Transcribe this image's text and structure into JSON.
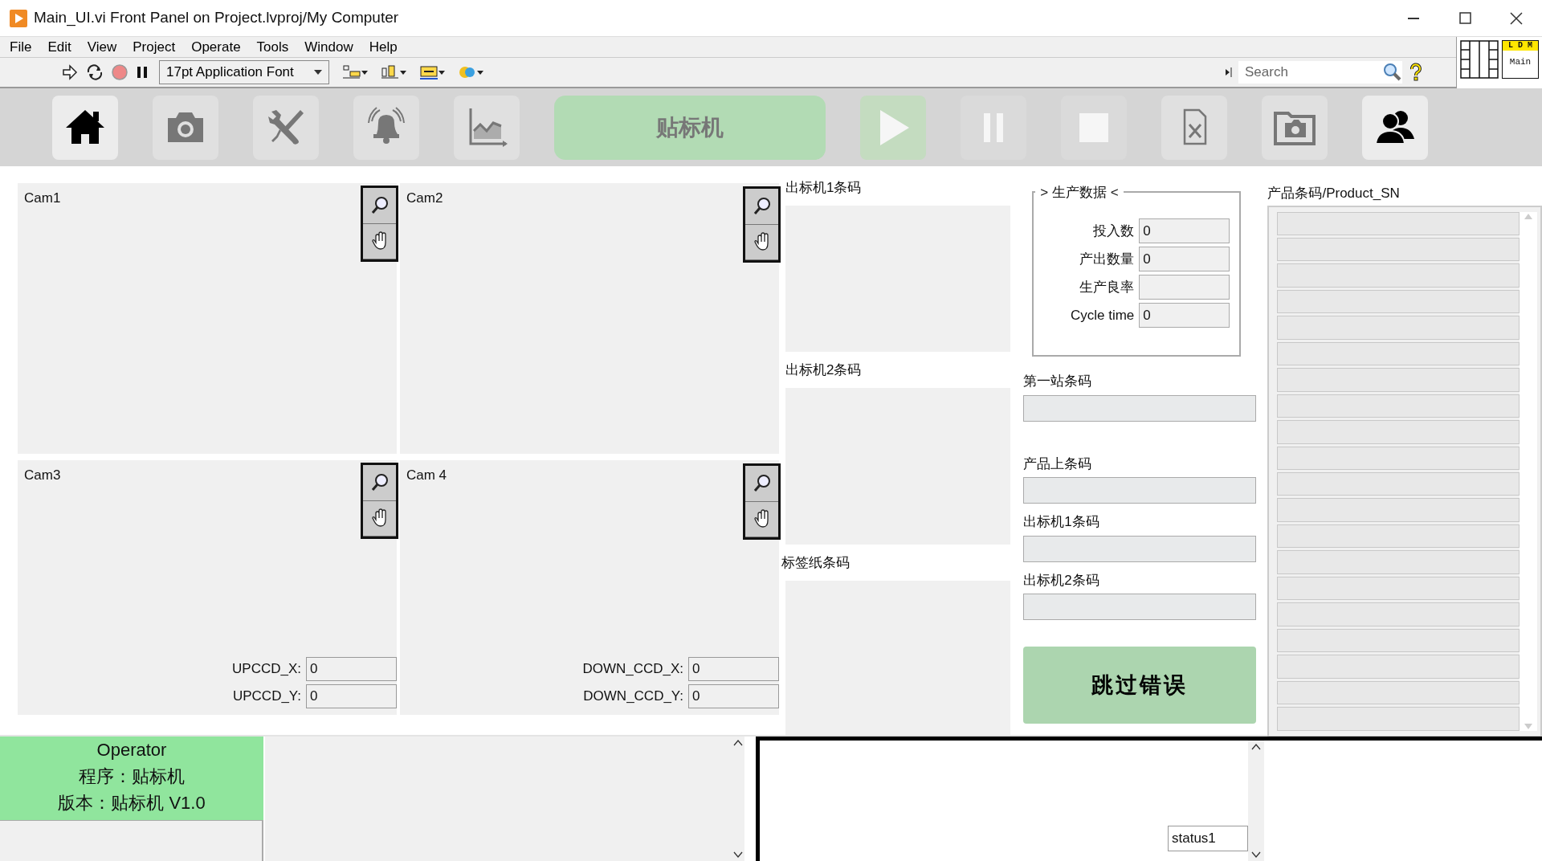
{
  "window": {
    "title": "Main_UI.vi Front Panel on Project.lvproj/My Computer"
  },
  "menu": [
    "File",
    "Edit",
    "View",
    "Project",
    "Operate",
    "Tools",
    "Window",
    "Help"
  ],
  "toolbar": {
    "font": "17pt Application Font",
    "search": {
      "placeholder": "Search"
    }
  },
  "vi_icon": {
    "banner": "L D M",
    "label": "Main"
  },
  "nav_buttons": [
    {
      "kind": "home",
      "active": true,
      "disabled": false
    },
    {
      "kind": "camera",
      "active": false,
      "disabled": false
    },
    {
      "kind": "tools",
      "active": false,
      "disabled": false
    },
    {
      "kind": "alarm",
      "active": false,
      "disabled": false
    },
    {
      "kind": "chart",
      "active": false,
      "disabled": false
    },
    {
      "kind": "title",
      "label": "贴标机",
      "disabled": false
    },
    {
      "kind": "play",
      "active": false,
      "disabled": true
    },
    {
      "kind": "pause",
      "active": false,
      "disabled": true
    },
    {
      "kind": "stop",
      "active": false,
      "disabled": true
    },
    {
      "kind": "document",
      "active": false,
      "disabled": false
    },
    {
      "kind": "snapshot",
      "active": false,
      "disabled": false
    },
    {
      "kind": "users",
      "active": true,
      "disabled": false
    }
  ],
  "cameras": [
    {
      "label": "Cam1"
    },
    {
      "label": "Cam2"
    },
    {
      "label": "Cam3",
      "fields": [
        {
          "label": "UPCCD_X:",
          "value": "0"
        },
        {
          "label": "UPCCD_Y:",
          "value": "0"
        }
      ]
    },
    {
      "label": "Cam 4",
      "fields": [
        {
          "label": "DOWN_CCD_X:",
          "value": "0"
        },
        {
          "label": "DOWN_CCD_Y:",
          "value": "0"
        }
      ]
    }
  ],
  "barcode_images": [
    {
      "label": "出标机1条码"
    },
    {
      "label": "出标机2条码"
    },
    {
      "label": "标签纸条码"
    }
  ],
  "production": {
    "title": "> 生产数据 <",
    "fields": [
      {
        "label": "投入数",
        "value": "0"
      },
      {
        "label": "产出数量",
        "value": "0"
      },
      {
        "label": "生产良率"
      },
      {
        "label": "Cycle time",
        "value": "0"
      }
    ]
  },
  "barcode_fields": [
    {
      "label": "第一站条码"
    },
    {
      "label": "产品上条码"
    },
    {
      "label": "出标机1条码"
    },
    {
      "label": "出标机2条码"
    }
  ],
  "skip_button": "跳过错误",
  "product_sn": {
    "label": "产品条码/Product_SN"
  },
  "operator": {
    "lines": [
      "Operator",
      "程序：贴标机",
      "版本：贴标机 V1.0"
    ]
  },
  "status": {
    "value": "status1"
  }
}
